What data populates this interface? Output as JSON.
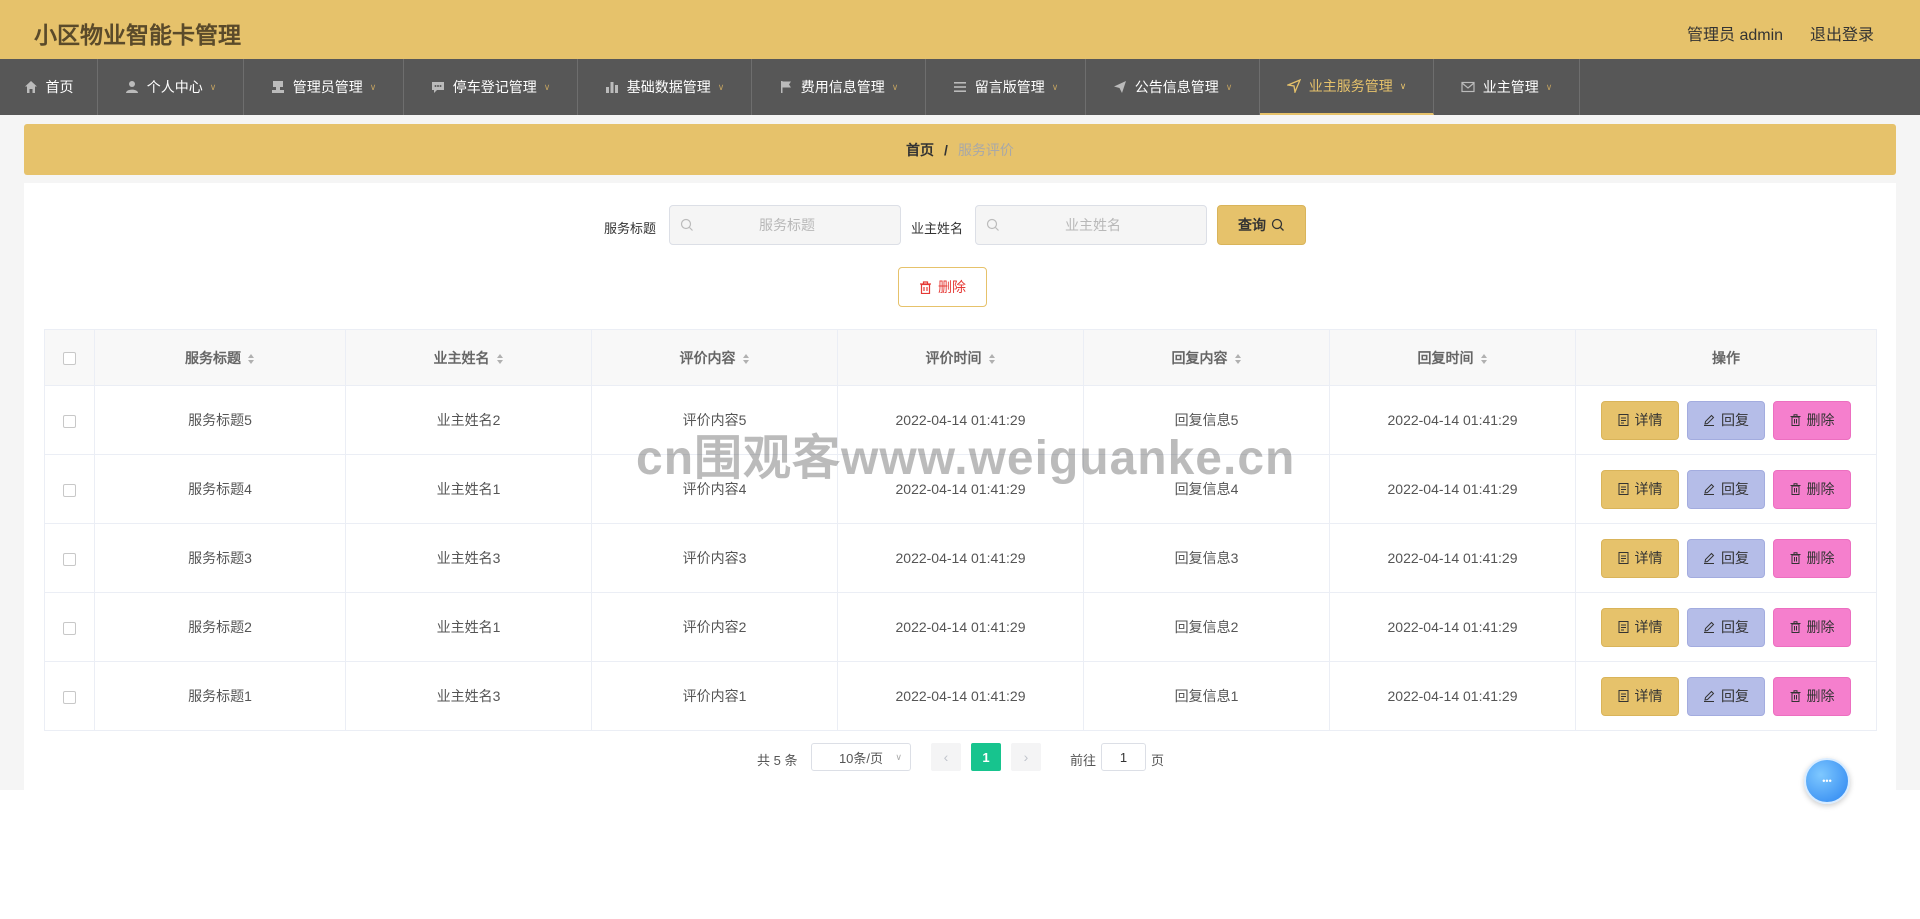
{
  "header": {
    "title": "小区物业智能卡管理",
    "user_label": "管理员 admin",
    "logout": "退出登录"
  },
  "nav": {
    "items": [
      {
        "label": "首页",
        "icon": "home-icon",
        "has_dropdown": false,
        "active": false
      },
      {
        "label": "个人中心",
        "icon": "user-icon",
        "has_dropdown": true,
        "active": false
      },
      {
        "label": "管理员管理",
        "icon": "stamp-icon",
        "has_dropdown": true,
        "active": false
      },
      {
        "label": "停车登记管理",
        "icon": "comment-icon",
        "has_dropdown": true,
        "active": false
      },
      {
        "label": "基础数据管理",
        "icon": "chart-icon",
        "has_dropdown": true,
        "active": false
      },
      {
        "label": "费用信息管理",
        "icon": "flag-icon",
        "has_dropdown": true,
        "active": false
      },
      {
        "label": "留言版管理",
        "icon": "list-icon",
        "has_dropdown": true,
        "active": false
      },
      {
        "label": "公告信息管理",
        "icon": "send-icon",
        "has_dropdown": true,
        "active": false
      },
      {
        "label": "业主服务管理",
        "icon": "location-icon",
        "has_dropdown": true,
        "active": true
      },
      {
        "label": "业主管理",
        "icon": "mail-icon",
        "has_dropdown": true,
        "active": false
      }
    ],
    "active_color": "#e6c26b"
  },
  "breadcrumb": {
    "home": "首页",
    "separator": "/",
    "current": "服务评价"
  },
  "search": {
    "title_label": "服务标题",
    "title_placeholder": "服务标题",
    "name_label": "业主姓名",
    "name_placeholder": "业主姓名",
    "query_button": "查询",
    "delete_button": "删除"
  },
  "table": {
    "columns": [
      "服务标题",
      "业主姓名",
      "评价内容",
      "评价时间",
      "回复内容",
      "回复时间",
      "操作"
    ],
    "rows": [
      {
        "title": "服务标题5",
        "owner": "业主姓名2",
        "content": "评价内容5",
        "time": "2022-04-14 01:41:29",
        "reply": "回复信息5",
        "reply_time": "2022-04-14 01:41:29"
      },
      {
        "title": "服务标题4",
        "owner": "业主姓名1",
        "content": "评价内容4",
        "time": "2022-04-14 01:41:29",
        "reply": "回复信息4",
        "reply_time": "2022-04-14 01:41:29"
      },
      {
        "title": "服务标题3",
        "owner": "业主姓名3",
        "content": "评价内容3",
        "time": "2022-04-14 01:41:29",
        "reply": "回复信息3",
        "reply_time": "2022-04-14 01:41:29"
      },
      {
        "title": "服务标题2",
        "owner": "业主姓名1",
        "content": "评价内容2",
        "time": "2022-04-14 01:41:29",
        "reply": "回复信息2",
        "reply_time": "2022-04-14 01:41:29"
      },
      {
        "title": "服务标题1",
        "owner": "业主姓名3",
        "content": "评价内容1",
        "time": "2022-04-14 01:41:29",
        "reply": "回复信息1",
        "reply_time": "2022-04-14 01:41:29"
      }
    ],
    "actions": {
      "detail": "详情",
      "reply": "回复",
      "delete": "删除"
    },
    "colors": {
      "detail": "#e6c26b",
      "reply": "#b5bde8",
      "delete": "#f57fcd"
    }
  },
  "pagination": {
    "total": "共 5 条",
    "page_size": "10条/页",
    "current_page": "1",
    "goto_prefix": "前往",
    "goto_value": "1",
    "goto_suffix": "页",
    "active_color": "#17c48e"
  },
  "watermark": "cn围观客www.weiguanke.cn"
}
